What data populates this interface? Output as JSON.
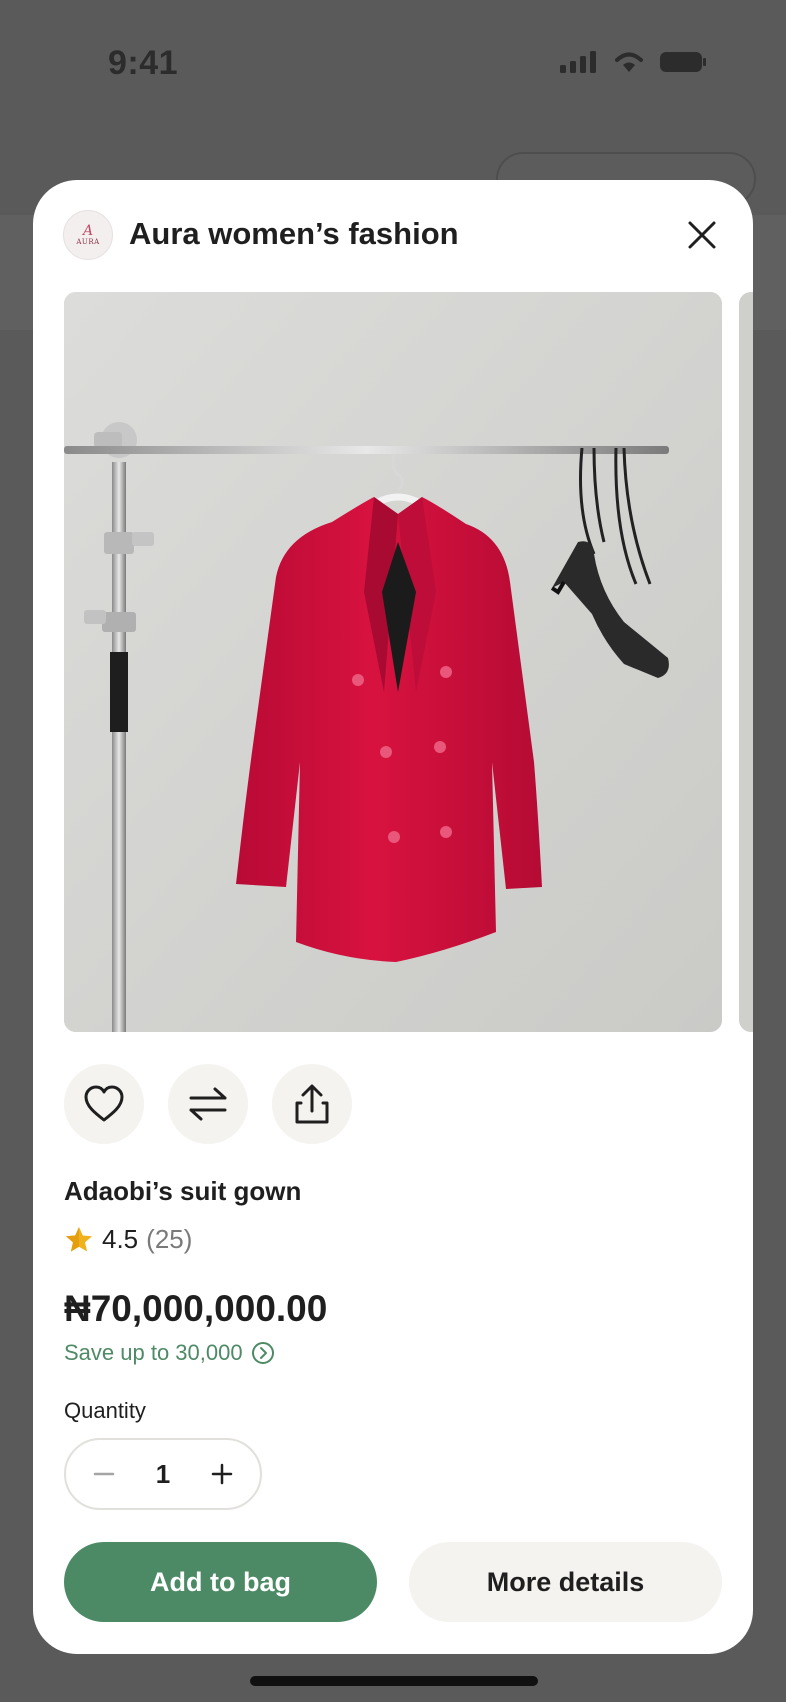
{
  "status_bar": {
    "time": "9:41"
  },
  "modal": {
    "store_name": "Aura women’s fashion",
    "store_logo_text": "AURA",
    "product": {
      "name": "Adaobi’s suit gown",
      "rating": "4.5",
      "rating_count": "(25)",
      "price": "₦70,000,000.00",
      "save_text": "Save up to 30,000",
      "quantity_label": "Quantity",
      "quantity": "1"
    },
    "buttons": {
      "add_to_bag": "Add to bag",
      "more_details": "More details"
    },
    "icons": {
      "close": "close-icon",
      "wishlist": "heart-icon",
      "compare": "compare-arrows-icon",
      "share": "share-icon",
      "star": "star-icon",
      "info": "chevron-right-circle-icon",
      "minus": "minus-icon",
      "plus": "plus-icon"
    }
  },
  "colors": {
    "accent_green": "#4c8a66",
    "save_text_green": "#4e8a65",
    "jacket_red": "#d0103f",
    "star_gold": "#f0b21c"
  }
}
